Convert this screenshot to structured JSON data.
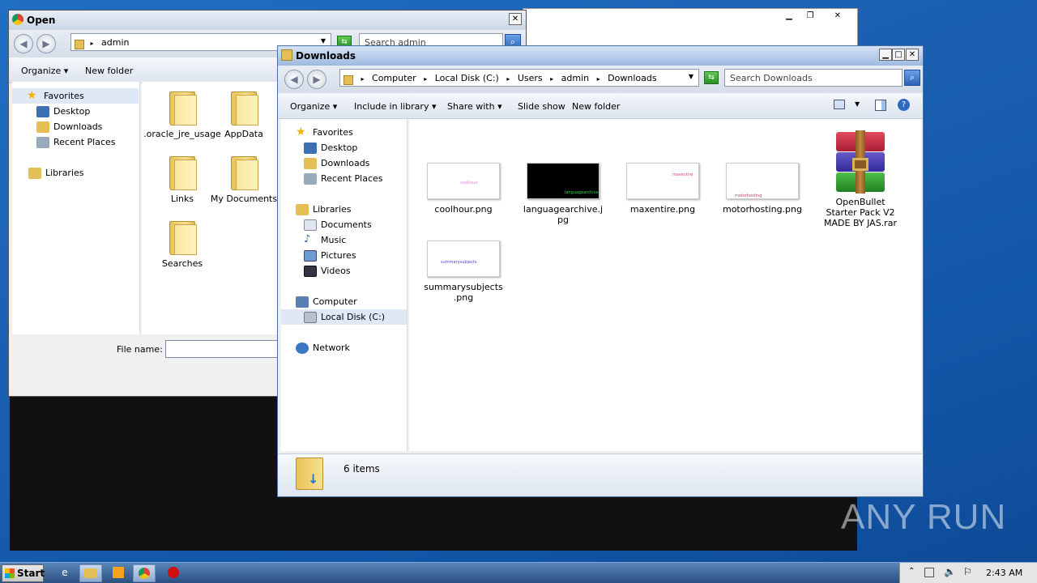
{
  "open_dialog": {
    "title": "Open",
    "address": "admin",
    "search_placeholder": "Search admin",
    "toolbar": {
      "organize": "Organize",
      "new_folder": "New folder"
    },
    "nav": [
      {
        "label": "Favorites"
      },
      {
        "label": "Desktop"
      },
      {
        "label": "Downloads"
      },
      {
        "label": "Recent Places"
      },
      {
        "label": "Libraries"
      }
    ],
    "items": [
      {
        "label": ".oracle_jre_usage"
      },
      {
        "label": "AppData"
      },
      {
        "label": "Links"
      },
      {
        "label": "My Documents"
      },
      {
        "label": "Searches"
      }
    ],
    "filename_label": "File name:",
    "filename_value": ""
  },
  "explorer": {
    "title": "Downloads",
    "breadcrumb": [
      "Computer",
      "Local Disk (C:)",
      "Users",
      "admin",
      "Downloads"
    ],
    "search_placeholder": "Search Downloads",
    "toolbar": {
      "organize": "Organize",
      "include_in_library": "Include in library",
      "share_with": "Share with",
      "slide_show": "Slide show",
      "new_folder": "New folder"
    },
    "nav": {
      "favorites": "Favorites",
      "desktop": "Desktop",
      "downloads": "Downloads",
      "recent_places": "Recent Places",
      "libraries": "Libraries",
      "documents": "Documents",
      "music": "Music",
      "pictures": "Pictures",
      "videos": "Videos",
      "computer": "Computer",
      "local_disk": "Local Disk (C:)",
      "network": "Network"
    },
    "files": [
      {
        "label": "coolhour.png"
      },
      {
        "label": "languagearchive.jpg"
      },
      {
        "label": "maxentire.png"
      },
      {
        "label": "motorhosting.png"
      },
      {
        "label": "OpenBullet Starter Pack V2 MADE BY JAS.rar"
      },
      {
        "label": "summarysubjects.png"
      }
    ],
    "status": "6 items"
  },
  "taskbar": {
    "start": "Start",
    "clock": "2:43 AM"
  },
  "watermark": "ANY RUN"
}
